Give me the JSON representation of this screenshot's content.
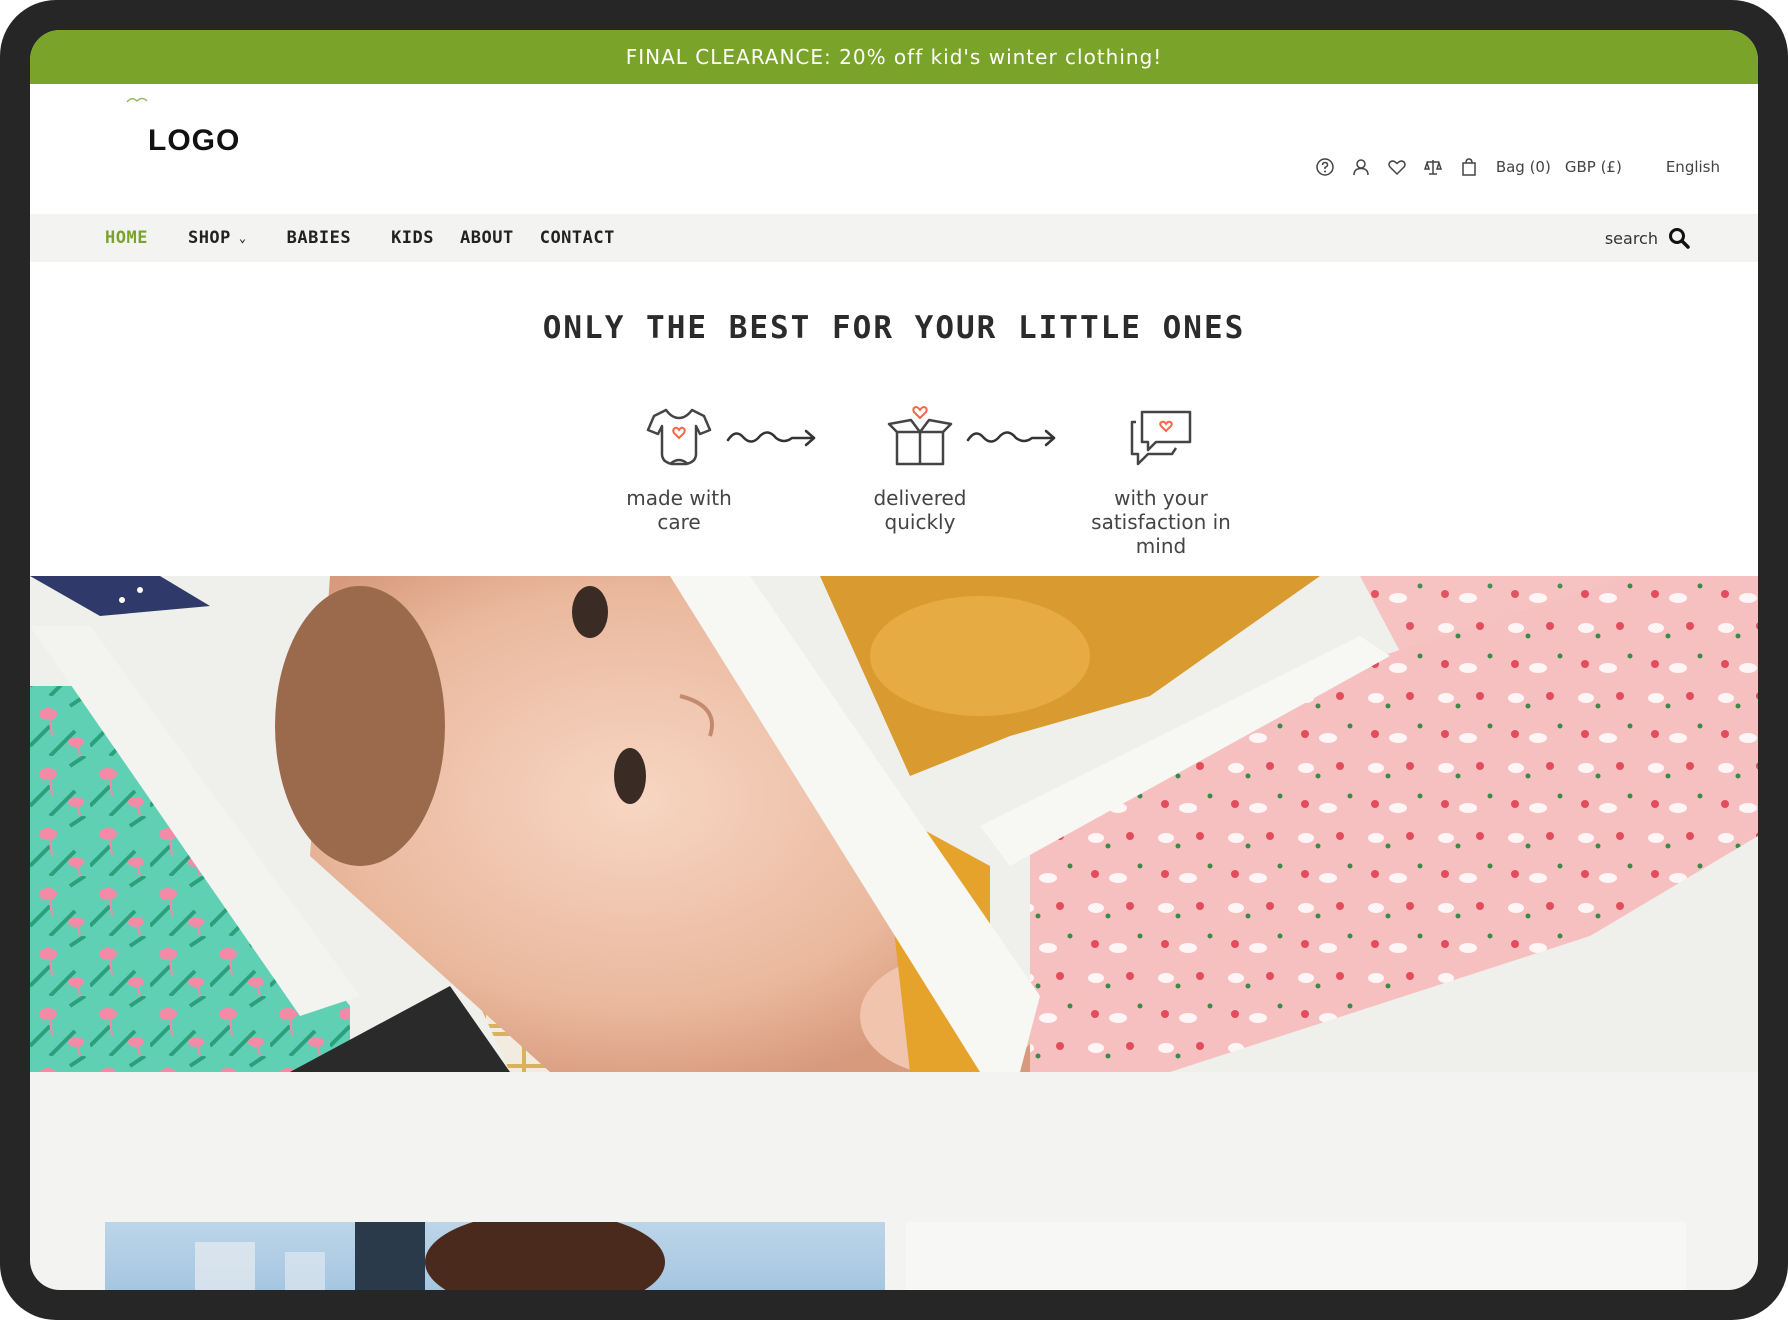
{
  "promo_banner": {
    "text": "FINAL CLEARANCE: 20% off kid's winter clothing!"
  },
  "header": {
    "logo": "LOGO",
    "utilities": {
      "icons": [
        "help-icon",
        "user-icon",
        "heart-icon",
        "compare-icon",
        "bag-icon"
      ],
      "bag": "Bag (0)",
      "currency": "GBP (£)",
      "language": "English"
    }
  },
  "nav": {
    "items": [
      {
        "label": "HOME",
        "active": true
      },
      {
        "label": "SHOP",
        "has_dropdown": true
      },
      {
        "label": "BABIES"
      },
      {
        "label": "KIDS"
      },
      {
        "label": "ABOUT"
      },
      {
        "label": "CONTACT"
      }
    ],
    "search_label": "search"
  },
  "values": {
    "title": "ONLY THE BEST FOR YOUR LITTLE ONES",
    "steps": [
      {
        "icon": "onesie-icon",
        "label_line1": "made with",
        "label_line2": "care"
      },
      {
        "icon": "gift-box-icon",
        "label_line1": "delivered",
        "label_line2": "quickly"
      },
      {
        "icon": "chat-heart-icon",
        "label_line1": "with your",
        "label_line2": "satisfaction in",
        "label_line3": "mind"
      }
    ]
  },
  "colors": {
    "accent": "#7aa32a",
    "heart": "#f06a4a",
    "text": "#2b2b2b"
  }
}
